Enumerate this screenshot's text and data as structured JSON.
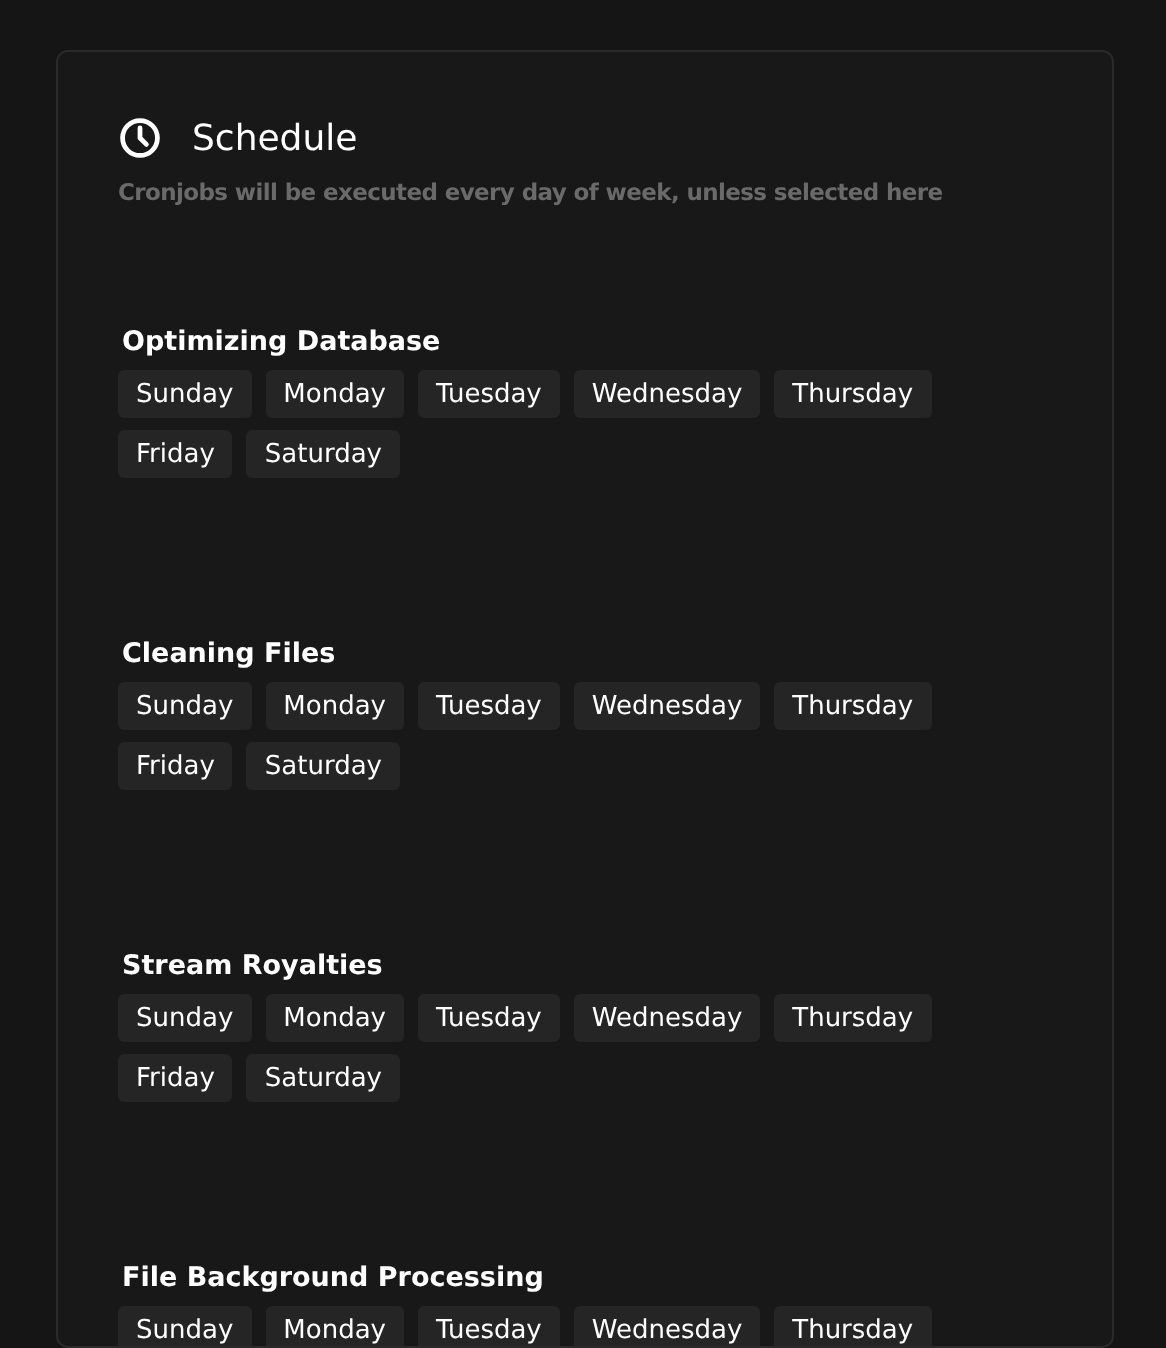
{
  "header": {
    "title": "Schedule",
    "subtitle": "Cronjobs will be executed every day of week, unless selected here"
  },
  "jobs": [
    {
      "name": "Optimizing Database",
      "days": [
        {
          "label": "Sunday",
          "selected": false
        },
        {
          "label": "Monday",
          "selected": false
        },
        {
          "label": "Tuesday",
          "selected": false
        },
        {
          "label": "Wednesday",
          "selected": false
        },
        {
          "label": "Thursday",
          "selected": false
        },
        {
          "label": "Friday",
          "selected": false
        },
        {
          "label": "Saturday",
          "selected": false
        }
      ]
    },
    {
      "name": "Cleaning Files",
      "days": [
        {
          "label": "Sunday",
          "selected": false
        },
        {
          "label": "Monday",
          "selected": false
        },
        {
          "label": "Tuesday",
          "selected": false
        },
        {
          "label": "Wednesday",
          "selected": false
        },
        {
          "label": "Thursday",
          "selected": false
        },
        {
          "label": "Friday",
          "selected": false
        },
        {
          "label": "Saturday",
          "selected": false
        }
      ]
    },
    {
      "name": "Stream Royalties",
      "days": [
        {
          "label": "Sunday",
          "selected": false
        },
        {
          "label": "Monday",
          "selected": false
        },
        {
          "label": "Tuesday",
          "selected": false
        },
        {
          "label": "Wednesday",
          "selected": false
        },
        {
          "label": "Thursday",
          "selected": false
        },
        {
          "label": "Friday",
          "selected": false
        },
        {
          "label": "Saturday",
          "selected": false
        }
      ]
    },
    {
      "name": "File Background Processing",
      "days": [
        {
          "label": "Sunday",
          "selected": false
        },
        {
          "label": "Monday",
          "selected": false
        },
        {
          "label": "Tuesday",
          "selected": false
        },
        {
          "label": "Wednesday",
          "selected": false
        },
        {
          "label": "Thursday",
          "selected": false
        }
      ]
    }
  ]
}
